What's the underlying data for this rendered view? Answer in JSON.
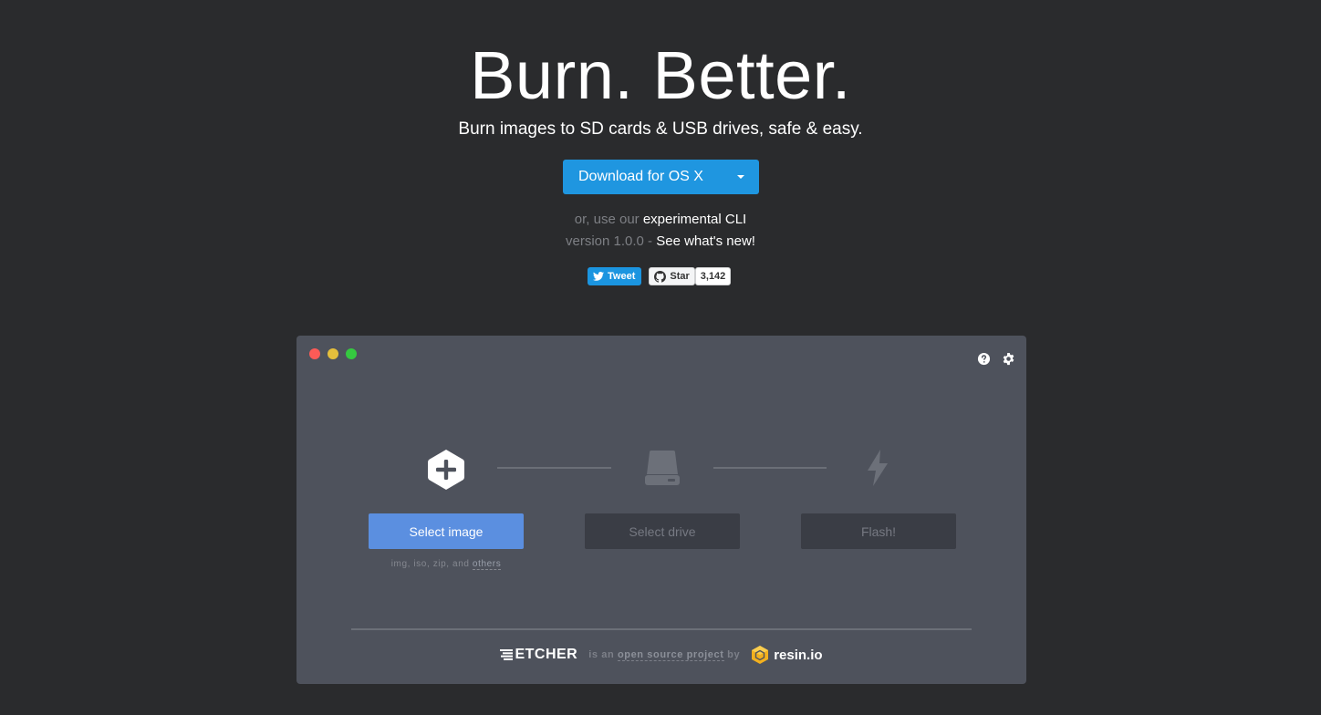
{
  "hero": {
    "title": "Burn. Better.",
    "subtitle": "Burn images to SD cards & USB drives, safe & easy.",
    "download_label": "Download for OS X",
    "cli_prefix": "or, use our ",
    "cli_link": "experimental CLI",
    "version_prefix": "version 1.0.0 - ",
    "version_link": "See what's new!"
  },
  "social": {
    "tweet_label": "Tweet",
    "star_label": "Star",
    "star_count": "3,142"
  },
  "app": {
    "steps": [
      {
        "label": "Select image",
        "icon": "plus-hexagon-icon",
        "state": "active"
      },
      {
        "label": "Select drive",
        "icon": "drive-icon",
        "state": "disabled"
      },
      {
        "label": "Flash!",
        "icon": "lightning-icon",
        "state": "disabled"
      }
    ],
    "formats_prefix": "img, iso, zip, and ",
    "formats_link": "others",
    "footer": {
      "etcher_name": "ETCHER",
      "text_prefix": "is an ",
      "text_link": "open source project",
      "text_suffix": " by",
      "resin_name": "resin.io"
    }
  },
  "colors": {
    "background": "#2a2b2d",
    "accent": "#1f96e0",
    "step_active": "#5b8fe0",
    "window": "#4e525c"
  }
}
